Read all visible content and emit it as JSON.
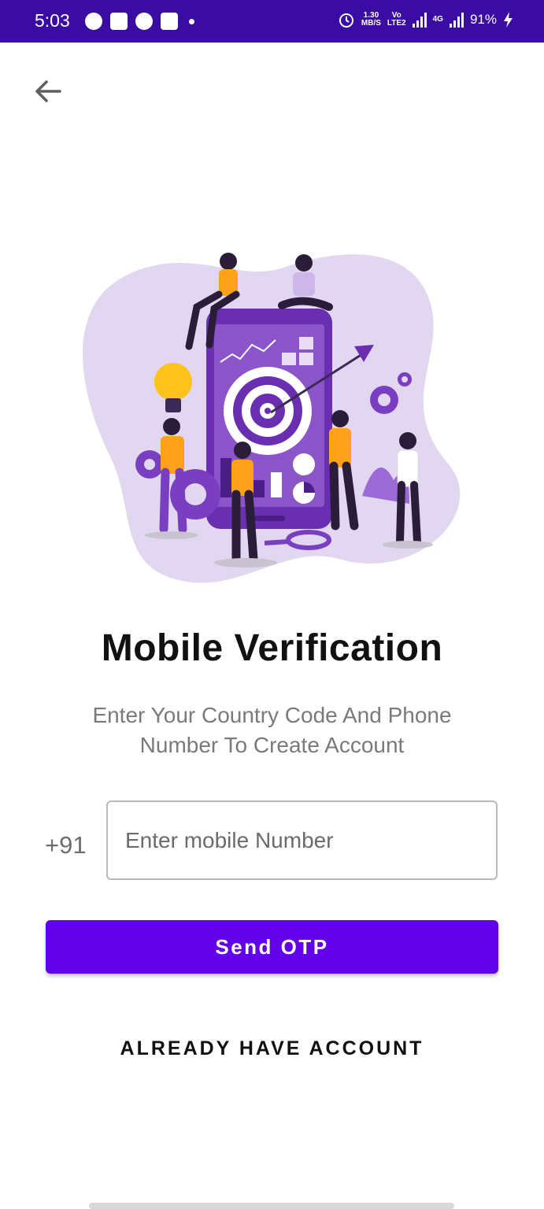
{
  "status_bar": {
    "time": "5:03",
    "speed_value": "1.30",
    "speed_unit": "MB/S",
    "volte_top": "Vo",
    "volte_bottom": "LTE2",
    "network_label": "4G",
    "battery": "91%"
  },
  "header": {
    "back_icon": "arrow-left-icon"
  },
  "illustration": {
    "subject": "mobile-marketing-target-illustration"
  },
  "main": {
    "title": "Mobile Verification",
    "subtitle": "Enter Your Country Code And Phone Number To Create Account",
    "country_code": "+91",
    "phone_placeholder": "Enter mobile Number",
    "send_button": "Send OTP",
    "already_link": "ALREADY HAVE ACCOUNT"
  },
  "colors": {
    "status_bar": "#3a0ca3",
    "primary": "#6200ea",
    "blob": "#e2d7f0",
    "phone_purple": "#6a2fb0",
    "accent_orange": "#ffa21a"
  }
}
